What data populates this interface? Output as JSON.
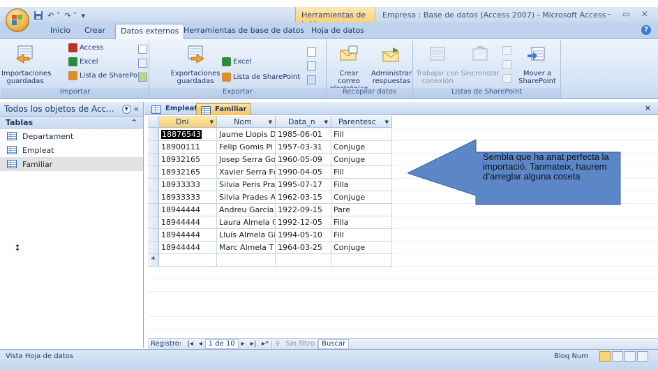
{
  "window": {
    "title": "Empresa : Base de datos (Access 2007) - Microsoft Access",
    "context_tab": "Herramientas de tabla",
    "controls": "– ▭ ✕"
  },
  "tabs": [
    "Inicio",
    "Crear",
    "Datos externos",
    "Herramientas de base de datos",
    "Hoja de datos"
  ],
  "ribbon": {
    "importar": {
      "label": "Importar",
      "big": "Importaciones guardadas",
      "items": [
        "Access",
        "Excel",
        "Lista de SharePoint"
      ]
    },
    "exportar": {
      "label": "Exportar",
      "big": "Exportaciones guardadas",
      "items": [
        "Excel",
        "Lista de SharePoint"
      ]
    },
    "recopilar": {
      "label": "Recopilar datos",
      "btn1": "Crear correo electrónico",
      "btn2": "Administrar respuestas"
    },
    "sharepoint": {
      "label": "Listas de SharePoint",
      "btn1": "Trabajar con conexión",
      "btn2": "Sincronizar",
      "btn3": "Mover a SharePoint"
    }
  },
  "nav": {
    "header": "Todos los objetos de Acc...",
    "group": "Tablas",
    "items": [
      "Departament",
      "Empleat",
      "Familiar"
    ],
    "selected": "Familiar"
  },
  "doc_tabs": [
    "Empleat",
    "Familiar"
  ],
  "table": {
    "columns": [
      "Dni",
      "Nom",
      "Data_n",
      "Parentesc"
    ],
    "rows": [
      [
        "18876543",
        "Jaume Llopis D",
        "1985-06-01",
        "Fill"
      ],
      [
        "18900111",
        "Felip Gomis Pi",
        "1957-03-31",
        "Conjuge"
      ],
      [
        "18932165",
        "Josep Serra Go",
        "1960-05-09",
        "Conjuge"
      ],
      [
        "18932165",
        "Xavier Serra Fc",
        "1990-04-05",
        "Fill"
      ],
      [
        "18933333",
        "Silvia Peris Pra",
        "1995-07-17",
        "Filla"
      ],
      [
        "18933333",
        "Silvia Prades A",
        "1962-03-15",
        "Conjuge"
      ],
      [
        "18944444",
        "Andreu García",
        "1922-09-15",
        "Pare"
      ],
      [
        "18944444",
        "Laura Almela C",
        "1992-12-05",
        "Filla"
      ],
      [
        "18944444",
        "Lluís Almela Gi",
        "1994-05-10",
        "Fill"
      ],
      [
        "18944444",
        "Marc Almela T",
        "1964-03-25",
        "Conjuge"
      ]
    ],
    "new_row_marker": "*"
  },
  "callout": {
    "text": "Sembla que ha anat perfecta la importació. Tanmateix, haurem d’arreglar alguna coseta"
  },
  "record_nav": {
    "label": "Registro:",
    "first": "|◂",
    "prev": "◂",
    "position": "1 de 10",
    "next": "▸",
    "last": "▸|",
    "new": "▸*",
    "filter": "Sin filtro",
    "search": "Buscar"
  },
  "status": {
    "left": "Vista Hoja de datos",
    "right": "Bloq Num"
  },
  "colors": {
    "accent": "#5b86c7",
    "active_tab": "#f6c35a"
  }
}
